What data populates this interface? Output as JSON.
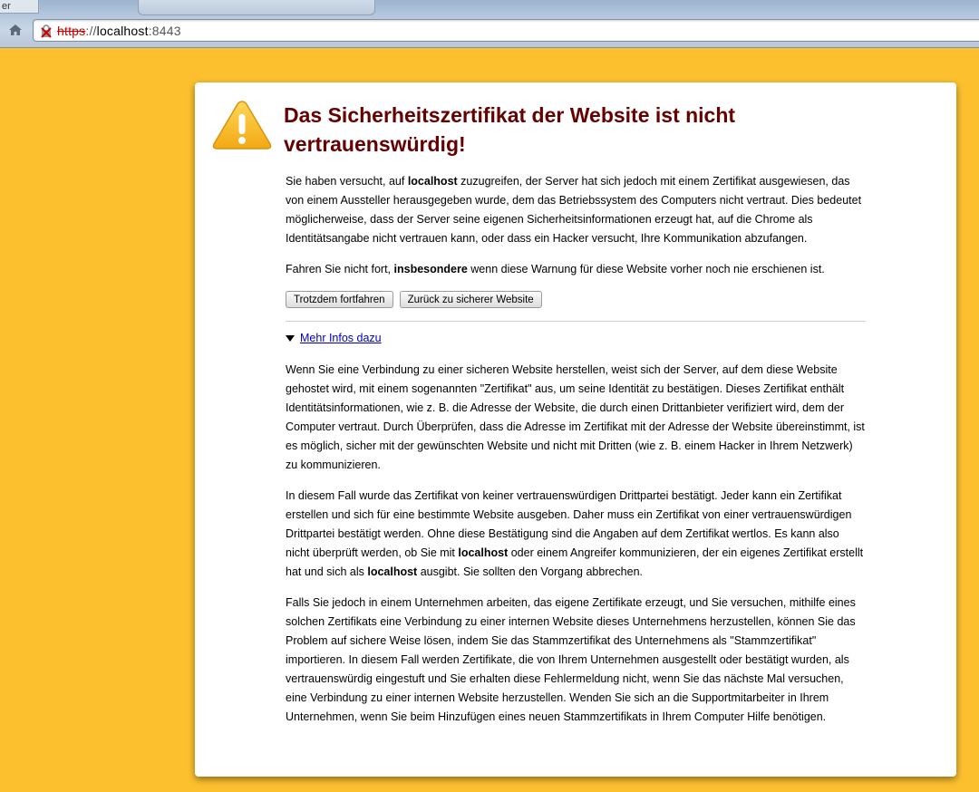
{
  "browser": {
    "tab_stub_text": "er",
    "url_scheme": "https",
    "url_sep": "://",
    "url_host": "localhost",
    "url_port": ":8443"
  },
  "colors": {
    "page_background": "#fcc02f",
    "title": "#660000",
    "link": "#0000cc"
  },
  "interstitial": {
    "title": "Das Sicherheitszertifikat der Website ist nicht vertrauenswürdig!",
    "intro": {
      "p1": "Sie haben versucht, auf ",
      "host": "localhost",
      "p2": " zuzugreifen, der Server hat sich jedoch mit einem Zertifikat ausgewiesen, das von einem Aussteller herausgegeben wurde, dem das Betriebssystem des Computers nicht vertraut. Dies bedeutet möglicherweise, dass der Server seine eigenen Sicherheitsinformationen erzeugt hat, auf die Chrome als Identitätsangabe nicht vertrauen kann, oder dass ein Hacker versucht, Ihre Kommunikation abzufangen."
    },
    "warning": {
      "p1": "Fahren Sie nicht fort, ",
      "emph": "insbesondere",
      "p2": " wenn diese Warnung für diese Website vorher noch nie erschienen ist."
    },
    "proceed_label": "Trotzdem fortfahren",
    "back_label": "Zurück zu sicherer Website",
    "more_info_label": "Mehr Infos dazu",
    "details": {
      "d1": "Wenn Sie eine Verbindung zu einer sicheren Website herstellen, weist sich der Server, auf dem diese Website gehostet wird, mit einem sogenannten \"Zertifikat\" aus, um seine Identität zu bestätigen. Dieses Zertifikat enthält Identitätsinformationen, wie z. B. die Adresse der Website, die durch einen Drittanbieter verifiziert wird, dem der Computer vertraut. Durch Überprüfen, dass die Adresse im Zertifikat mit der Adresse der Website übereinstimmt, ist es möglich, sicher mit der gewünschten Website und nicht mit Dritten (wie z. B. einem Hacker in Ihrem Netzwerk) zu kommunizieren.",
      "d2a": "In diesem Fall wurde das Zertifikat von keiner vertrauenswürdigen Drittpartei bestätigt. Jeder kann ein Zertifikat erstellen und sich für eine bestimmte Website ausgeben. Daher muss ein Zertifikat von einer vertrauenswürdigen Drittpartei bestätigt werden. Ohne diese Bestätigung sind die Angaben auf dem Zertifikat wertlos. Es kann also nicht überprüft werden, ob Sie mit ",
      "d2_host1": "localhost",
      "d2b": " oder einem Angreifer kommunizieren, der ein eigenes Zertifikat erstellt hat und sich als ",
      "d2_host2": "localhost",
      "d2c": " ausgibt. Sie sollten den Vorgang abbrechen.",
      "d3": "Falls Sie jedoch in einem Unternehmen arbeiten, das eigene Zertifikate erzeugt, und Sie versuchen, mithilfe eines solchen Zertifikats eine Verbindung zu einer internen Website dieses Unternehmens herzustellen, können Sie das Problem auf sichere Weise lösen, indem Sie das Stammzertifikat des Unternehmens als \"Stammzertifikat\" importieren. In diesem Fall werden Zertifikate, die von Ihrem Unternehmen ausgestellt oder bestätigt wurden, als vertrauenswürdig eingestuft und Sie erhalten diese Fehlermeldung nicht, wenn Sie das nächste Mal versuchen, eine Verbindung zu einer internen Website herzustellen. Wenden Sie sich an die Supportmitarbeiter in Ihrem Unternehmen, wenn Sie beim Hinzufügen eines neuen Stammzertifikats in Ihrem Computer Hilfe benötigen."
    }
  }
}
